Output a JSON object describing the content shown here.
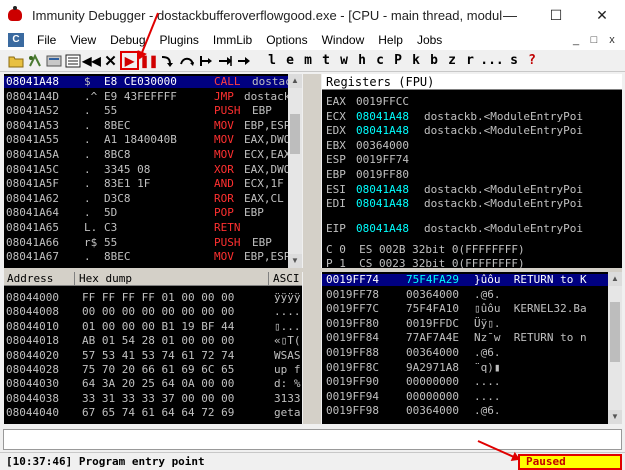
{
  "window": {
    "title": "Immunity Debugger - dostackbufferoverflowgood.exe - [CPU - main thread, module...",
    "minimize": "—",
    "maximize": "☐",
    "close": "✕"
  },
  "menu": {
    "items": [
      "File",
      "View",
      "Debug",
      "Plugins",
      "ImmLib",
      "Options",
      "Window",
      "Help",
      "Jobs"
    ],
    "mdi": [
      "_",
      "□",
      "x"
    ]
  },
  "toolbar": {
    "letters": [
      "l",
      "e",
      "m",
      "t",
      "w",
      "h",
      "c",
      "P",
      "k",
      "b",
      "z",
      "r",
      "...",
      "s",
      "?"
    ]
  },
  "cpu": {
    "rows": [
      {
        "addr": "08041A48",
        "mark": "$",
        "bytes": "E8 CE030000",
        "mnem": "CALL",
        "op": "dostac"
      },
      {
        "addr": "08041A4D",
        "mark": ".^",
        "bytes": "E9 43FEFFFF",
        "mnem": "JMP",
        "op": "dostack"
      },
      {
        "addr": "08041A52",
        "mark": ".",
        "bytes": "55",
        "mnem": "PUSH",
        "op": "EBP"
      },
      {
        "addr": "08041A53",
        "mark": ".",
        "bytes": "8BEC",
        "mnem": "MOV",
        "op": "EBP,ESP"
      },
      {
        "addr": "08041A55",
        "mark": ".",
        "bytes": "A1 1840040B",
        "mnem": "MOV",
        "op": "EAX,DWO"
      },
      {
        "addr": "08041A5A",
        "mark": ".",
        "bytes": "8BC8",
        "mnem": "MOV",
        "op": "ECX,EAX"
      },
      {
        "addr": "08041A5C",
        "mark": ".",
        "bytes": "3345 08",
        "mnem": "XOR",
        "op": "EAX,DWO"
      },
      {
        "addr": "08041A5F",
        "mark": ".",
        "bytes": "83E1 1F",
        "mnem": "AND",
        "op": "ECX,1F"
      },
      {
        "addr": "08041A62",
        "mark": ".",
        "bytes": "D3C8",
        "mnem": "ROR",
        "op": "EAX,CL"
      },
      {
        "addr": "08041A64",
        "mark": ".",
        "bytes": "5D",
        "mnem": "POP",
        "op": "EBP"
      },
      {
        "addr": "08041A65",
        "mark": "L.",
        "bytes": "C3",
        "mnem": "RETN",
        "op": ""
      },
      {
        "addr": "08041A66",
        "mark": "r$",
        "bytes": "55",
        "mnem": "PUSH",
        "op": "EBP"
      },
      {
        "addr": "08041A67",
        "mark": ".",
        "bytes": "8BEC",
        "mnem": "MOV",
        "op": "EBP,ESP"
      }
    ]
  },
  "registers": {
    "header": "Registers (FPU)",
    "rows": [
      {
        "name": "EAX",
        "value": "0019FFCC",
        "comment": ""
      },
      {
        "name": "ECX",
        "value": "08041A48",
        "comment": "dostackb.<ModuleEntryPoi"
      },
      {
        "name": "EDX",
        "value": "08041A48",
        "comment": "dostackb.<ModuleEntryPoi"
      },
      {
        "name": "EBX",
        "value": "00364000",
        "comment": ""
      },
      {
        "name": "ESP",
        "value": "0019FF74",
        "comment": ""
      },
      {
        "name": "EBP",
        "value": "0019FF80",
        "comment": ""
      },
      {
        "name": "ESI",
        "value": "08041A48",
        "comment": "dostackb.<ModuleEntryPoi"
      },
      {
        "name": "EDI",
        "value": "08041A48",
        "comment": "dostackb.<ModuleEntryPoi"
      },
      {
        "name": "EIP",
        "value": "08041A48",
        "comment": "dostackb.<ModuleEntryPoi"
      }
    ],
    "flags": [
      "C 0  ES 002B 32bit 0(FFFFFFFF)",
      "P 1  CS 0023 32bit 0(FFFFFFFF)"
    ]
  },
  "hexdump": {
    "header_address": "Address",
    "header_hex": "Hex dump",
    "header_ascii": "ASCI",
    "rows": [
      {
        "addr": "08044000",
        "hex": "FF FF FF FF 01 00 00 00",
        "ascii": "ÿÿÿÿ"
      },
      {
        "addr": "08044008",
        "hex": "00 00 00 00 00 00 00 00",
        "ascii": "...."
      },
      {
        "addr": "08044010",
        "hex": "01 00 00 00 B1 19 BF 44",
        "ascii": "▯..."
      },
      {
        "addr": "08044018",
        "hex": "AB 01 54 28 01 00 00 00",
        "ascii": "«▯T("
      },
      {
        "addr": "08044020",
        "hex": "57 53 41 53 74 61 72 74",
        "ascii": "WSAS"
      },
      {
        "addr": "08044028",
        "hex": "75 70 20 66 61 69 6C 65",
        "ascii": "up f"
      },
      {
        "addr": "08044030",
        "hex": "64 3A 20 25 64 0A 00 00",
        "ascii": "d: %"
      },
      {
        "addr": "08044038",
        "hex": "33 31 33 33 37 00 00 00",
        "ascii": "3133"
      },
      {
        "addr": "08044040",
        "hex": "67 65 74 61 64 64 72 69",
        "ascii": "geta"
      }
    ]
  },
  "stack": {
    "rows": [
      {
        "addr": "0019FF74",
        "value": "75F4FA29",
        "comment": "}ûôu  RETURN to K",
        "highlight": true
      },
      {
        "addr": "0019FF78",
        "value": "00364000",
        "comment": ".@6.",
        "highlight": false
      },
      {
        "addr": "0019FF7C",
        "value": "75F4FA10",
        "comment": "▯ûôu  KERNEL32.Ba",
        "highlight": false
      },
      {
        "addr": "0019FF80",
        "value": "0019FFDC",
        "comment": "Üÿ▯.",
        "highlight": false
      },
      {
        "addr": "0019FF84",
        "value": "77AF7A4E",
        "comment": "Nz¯w  RETURN to n",
        "highlight": false
      },
      {
        "addr": "0019FF88",
        "value": "00364000",
        "comment": ".@6.",
        "highlight": false
      },
      {
        "addr": "0019FF8C",
        "value": "9A2971A8",
        "comment": "¨q)▮",
        "highlight": false
      },
      {
        "addr": "0019FF90",
        "value": "00000000",
        "comment": "....",
        "highlight": false
      },
      {
        "addr": "0019FF94",
        "value": "00000000",
        "comment": "....",
        "highlight": false
      },
      {
        "addr": "0019FF98",
        "value": "00364000",
        "comment": ".@6.",
        "highlight": false
      }
    ]
  },
  "status": {
    "message": "[10:37:46] Program entry point",
    "state": "Paused"
  },
  "colors": {
    "pane_bg": "#000000",
    "row_text": "#c0c0c0",
    "mnemonic": "#ff3030",
    "selection": "#000080",
    "highlight_value": "#00ffff",
    "paused_bg": "#ffff00",
    "annotation": "#e00000"
  },
  "icons": [
    "open-folder-icon",
    "restart-icon",
    "close-icon",
    "run-icon",
    "pause-icon",
    "step-into-icon",
    "step-over-icon"
  ]
}
